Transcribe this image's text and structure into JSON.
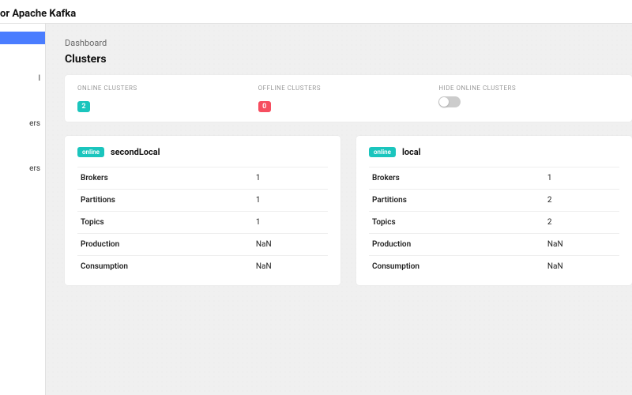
{
  "topbar": {
    "title": "or Apache Kafka"
  },
  "sidebar": {
    "items": [
      {
        "label": ""
      },
      {
        "label": "l"
      },
      {
        "label": "ers"
      },
      {
        "label": "ers"
      }
    ]
  },
  "breadcrumb": "Dashboard",
  "page_title": "Clusters",
  "stats": {
    "online": {
      "label": "ONLINE CLUSTERS",
      "value": "2"
    },
    "offline": {
      "label": "OFFLINE CLUSTERS",
      "value": "0"
    },
    "hide": {
      "label": "HIDE ONLINE CLUSTERS"
    }
  },
  "clusters": [
    {
      "status": "online",
      "name": "secondLocal",
      "rows": [
        {
          "k": "Brokers",
          "v": "1"
        },
        {
          "k": "Partitions",
          "v": "1"
        },
        {
          "k": "Topics",
          "v": "1"
        },
        {
          "k": "Production",
          "v": "NaN"
        },
        {
          "k": "Consumption",
          "v": "NaN"
        }
      ]
    },
    {
      "status": "online",
      "name": "local",
      "rows": [
        {
          "k": "Brokers",
          "v": "1"
        },
        {
          "k": "Partitions",
          "v": "2"
        },
        {
          "k": "Topics",
          "v": "2"
        },
        {
          "k": "Production",
          "v": "NaN"
        },
        {
          "k": "Consumption",
          "v": "NaN"
        }
      ]
    }
  ]
}
